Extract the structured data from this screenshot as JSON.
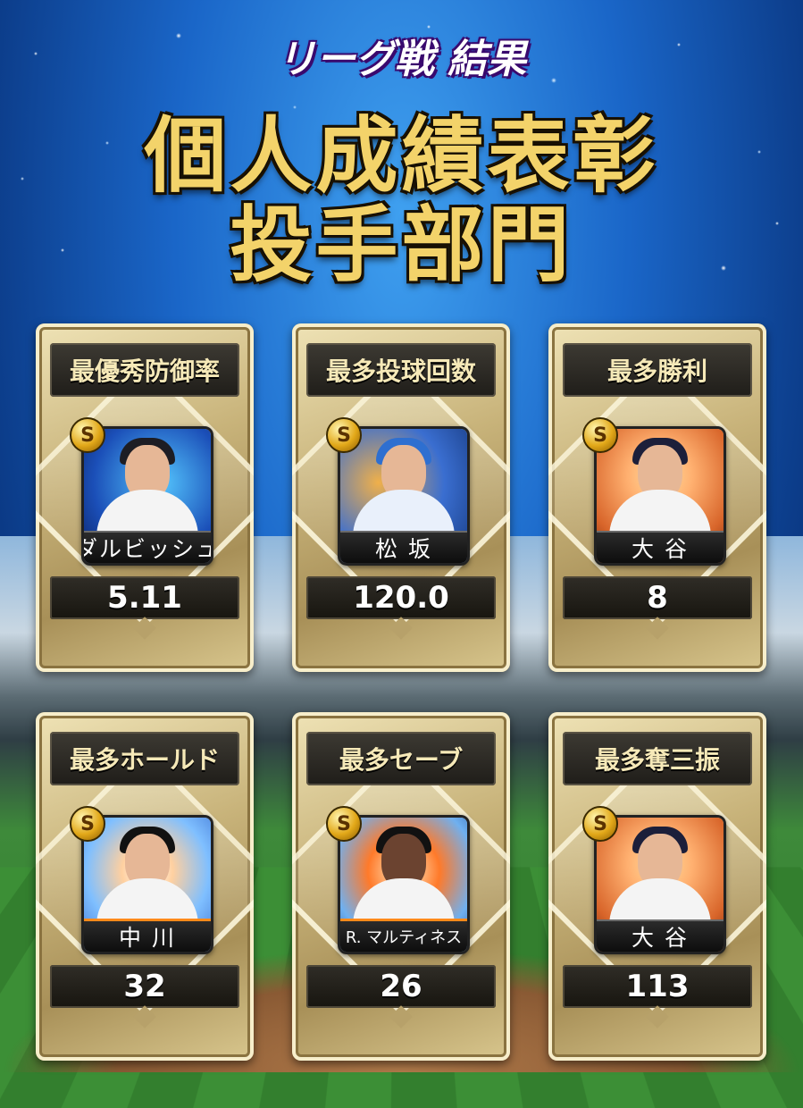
{
  "header": {
    "subtitle": "リーグ戦 結果",
    "headline_line1": "個人成績表彰",
    "headline_line2": "投手部門"
  },
  "colors": {
    "sky_blue": "#1a66c8",
    "headline_gold": "#f3d36a",
    "card_gold": "#c8b37a",
    "badge_gold": "#e2a819"
  },
  "rank_badge_letter": "S",
  "awards": [
    {
      "title": "最優秀防御率",
      "player": "ダルビッシュ",
      "value": "5.11",
      "team_color": "#1b4fb8",
      "accent": "#55c7ff"
    },
    {
      "title": "最多投球回数",
      "player": "松 坂",
      "value": "120.0",
      "team_color": "#3a6ed0",
      "accent": "#f0b04a"
    },
    {
      "title": "最多勝利",
      "player": "大 谷",
      "value": "8",
      "team_color": "#d8652a",
      "accent": "#ffb070"
    },
    {
      "title": "最多ホールド",
      "player": "中 川",
      "value": "32",
      "team_color": "#7fbfff",
      "accent": "#ff9a3a"
    },
    {
      "title": "最多セーブ",
      "player": "R. マルティネス",
      "value": "26",
      "team_color": "#6fb0f0",
      "accent": "#ff7a2a"
    },
    {
      "title": "最多奪三振",
      "player": "大 谷",
      "value": "113",
      "team_color": "#d8652a",
      "accent": "#ffb070"
    }
  ]
}
